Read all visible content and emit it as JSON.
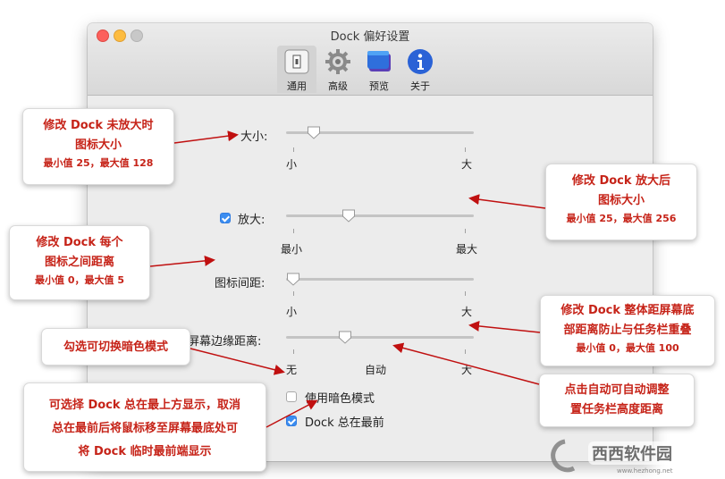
{
  "window": {
    "title": "Dock 偏好设置",
    "toolbar": [
      {
        "label": "通用",
        "icon": "general-icon",
        "selected": true
      },
      {
        "label": "高级",
        "icon": "gear-icon",
        "selected": false
      },
      {
        "label": "预览",
        "icon": "preview-icon",
        "selected": false
      },
      {
        "label": "关于",
        "icon": "info-icon",
        "selected": false
      }
    ]
  },
  "settings": {
    "size": {
      "label": "大小:",
      "min_label": "小",
      "max_label": "大",
      "value_fraction": 0.15
    },
    "magnification": {
      "checked": true,
      "label": "放大:",
      "min_label": "最小",
      "max_label": "最大",
      "value_fraction": 0.33
    },
    "spacing": {
      "label": "图标间距:",
      "min_label": "小",
      "max_label": "大",
      "value_fraction": 0.0
    },
    "screen_edge": {
      "label": "屏幕边缘距离:",
      "min_label": "无",
      "mid_label": "自动",
      "max_label": "大",
      "value_fraction": 0.3
    },
    "dark_mode": {
      "checked": false,
      "label": "使用暗色模式"
    },
    "always_on_top": {
      "checked": true,
      "label": "Dock 总在最前"
    }
  },
  "annotations": {
    "size": {
      "line1": "修改 Dock 未放大时",
      "line2": "图标大小",
      "line3": "最小值 25，最大值 128"
    },
    "magnify": {
      "line1": "修改 Dock 放大后",
      "line2": "图标大小",
      "line3": "最小值 25，最大值 256"
    },
    "spacing": {
      "line1": "修改 Dock 每个",
      "line2": "图标之间距离",
      "line3": "最小值 0，最大值 5"
    },
    "edge": {
      "line1": "修改 Dock 整体距屏幕底",
      "line2": "部距离防止与任务栏重叠",
      "line3": "最小值 0，最大值 100"
    },
    "dark": {
      "line1": "勾选可切换暗色模式"
    },
    "auto": {
      "line1": "点击自动可自动调整",
      "line2": "置任务栏高度距离"
    },
    "top": {
      "line1": "可选择 Dock 总在最上方显示，取消",
      "line2": "总在最前后将鼠标移至屏幕最底处可",
      "line3": "将 Dock 临时最前端显示"
    }
  },
  "watermark": {
    "text": "西西软件园",
    "url": "www.hezhong.net"
  },
  "colors": {
    "annotation": "#c62318",
    "arrow": "#c01010",
    "accent": "#3b8df0"
  }
}
